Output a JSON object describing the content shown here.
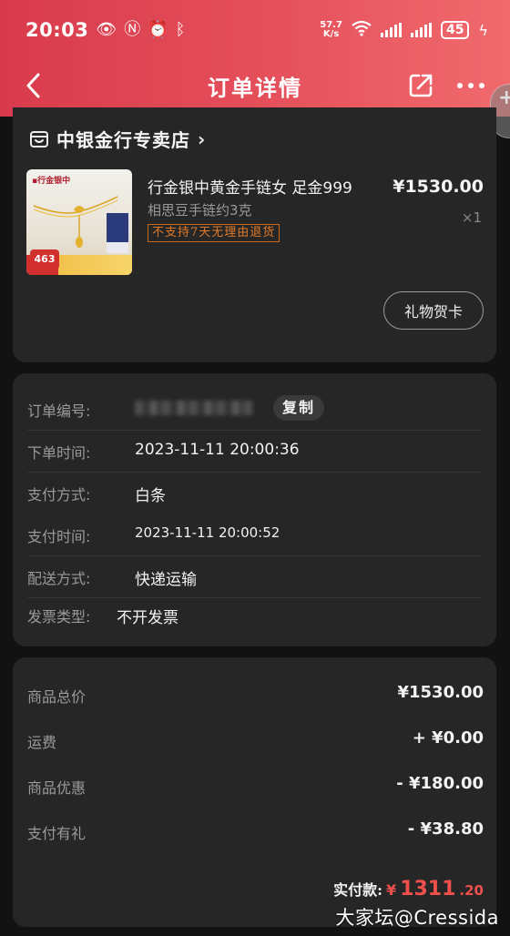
{
  "status_bar": {
    "time": "20:03",
    "net_speed_value": "57.7",
    "net_speed_unit": "K/s",
    "battery": "45"
  },
  "nav": {
    "title": "订单详情"
  },
  "store": {
    "name": "中银金行专卖店"
  },
  "product": {
    "title": "行金银中黄金手链女 足金999",
    "subtitle": "相思豆手链约3克",
    "badge": "不支持7天无理由退货",
    "price": "¥1530.00",
    "quantity": "×1",
    "thumb_badge": "463",
    "gift_card_label": "礼物贺卡"
  },
  "order_info": {
    "order_no_label": "订单编号:",
    "copy_label": "复制",
    "order_time_label": "下单时间:",
    "order_time": "2023-11-11 20:00:36",
    "payment_method_label": "支付方式:",
    "payment_method": "白条",
    "payment_time_label": "支付时间:",
    "payment_time": "2023-11-11 20:00:52",
    "delivery_label": "配送方式:",
    "delivery": "快递运输",
    "invoice_label": "发票类型:",
    "invoice": "不开发票"
  },
  "price_summary": {
    "subtotal_label": "商品总价",
    "subtotal": "¥1530.00",
    "shipping_label": "运费",
    "shipping": "+ ¥0.00",
    "discount_label": "商品优惠",
    "discount": "- ¥180.00",
    "gift_label": "支付有礼",
    "gift": "- ¥38.80",
    "total_label": "实付款:",
    "total_currency": "¥",
    "total_integer": "1311",
    "total_decimal": ".20"
  },
  "watermark": "大家坛@Cressida",
  "colors": {
    "header_red": "#e34c58",
    "total_red": "#f0504c",
    "badge_orange": "#e07a2a",
    "card_bg": "#262626",
    "page_bg": "#121212"
  }
}
